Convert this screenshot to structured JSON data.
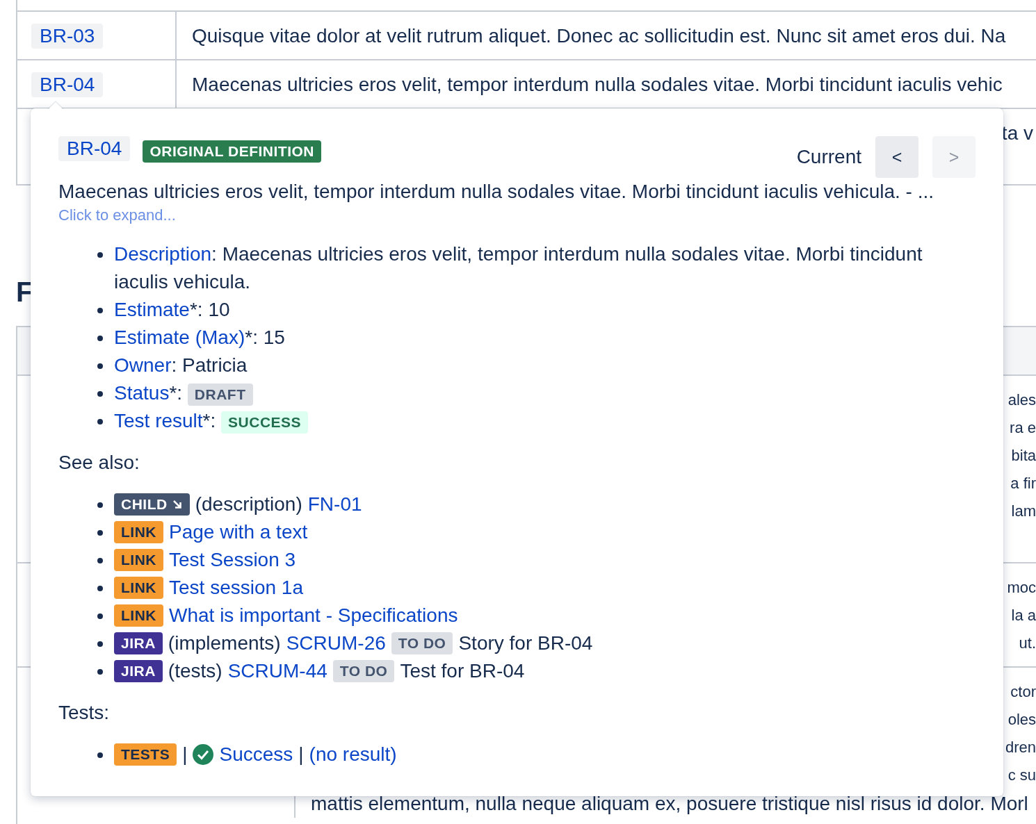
{
  "requirements_table": {
    "rows": [
      {
        "id": "BR-03",
        "description": "Quisque vitae dolor at velit rutrum aliquet. Donec ac sollicitudin est. Nunc sit amet eros dui. Na"
      },
      {
        "id": "BR-04",
        "description": "Maecenas ultricies eros velit, tempor interdum nulla sodales vitae. Morbi tincidunt iaculis vehic"
      },
      {
        "description": "ta v"
      }
    ]
  },
  "section_heading": "F",
  "second_table": {
    "rows": [
      {
        "fragments": [
          "ales",
          "ra e",
          "bita",
          "a fir",
          "lam"
        ]
      },
      {
        "fragments": [
          "moc",
          "la a",
          "ut."
        ]
      },
      {
        "fragments": [
          "ctor",
          "oles",
          "dren",
          "c su"
        ],
        "line": "mattis elementum, nulla neque aliquam ex, posuere tristique nisl risus id dolor. Morl"
      }
    ]
  },
  "popover": {
    "id": "BR-04",
    "tag": "ORIGINAL DEFINITION",
    "current_label": "Current",
    "prev_button": {
      "label": "<",
      "disabled": false
    },
    "next_button": {
      "label": ">",
      "disabled": true
    },
    "summary": "Maecenas ultricies eros velit, tempor interdum nulla sodales vitae. Morbi tincidunt iaculis vehicula. - ...",
    "expand_link": "Click to expand...",
    "fields": [
      {
        "name": "Description",
        "separator": ":",
        "kind": "text",
        "value": "Maecenas ultricies eros velit, tempor interdum nulla sodales vitae. Morbi tincidunt iaculis vehicula."
      },
      {
        "name": "Estimate",
        "separator": "*:",
        "kind": "text",
        "value": "10"
      },
      {
        "name": "Estimate (Max)",
        "separator": "*:",
        "kind": "text",
        "value": "15"
      },
      {
        "name": "Owner",
        "separator": ":",
        "kind": "text",
        "value": "Patricia"
      },
      {
        "name": "Status",
        "separator": "*:",
        "kind": "status",
        "value": "DRAFT"
      },
      {
        "name": "Test result",
        "separator": "*:",
        "kind": "result",
        "value": "SUCCESS"
      }
    ],
    "see_also_label": "See also:",
    "see_also": [
      {
        "kind": "child",
        "tag": "CHILD",
        "relation": "(description)",
        "link": "FN-01"
      },
      {
        "kind": "link",
        "tag": "LINK",
        "link": "Page with a text"
      },
      {
        "kind": "link",
        "tag": "LINK",
        "link": "Test Session 3"
      },
      {
        "kind": "link",
        "tag": "LINK",
        "link": "Test session 1a"
      },
      {
        "kind": "link",
        "tag": "LINK",
        "link": "What is important - Specifications"
      },
      {
        "kind": "jira",
        "tag": "JIRA",
        "relation": "(implements)",
        "link": "SCRUM-26",
        "status": "TO DO",
        "summary": "Story for BR-04"
      },
      {
        "kind": "jira",
        "tag": "JIRA",
        "relation": "(tests)",
        "link": "SCRUM-44",
        "status": "TO DO",
        "summary": "Test for BR-04"
      }
    ],
    "tests_label": "Tests:",
    "tests": [
      {
        "tag": "TESTS",
        "parts": [
          {
            "kind": "separator",
            "text": "|"
          },
          {
            "kind": "success",
            "text": "Success"
          },
          {
            "kind": "separator",
            "text": "|"
          },
          {
            "kind": "link",
            "text": "(no result)"
          }
        ]
      }
    ]
  }
}
